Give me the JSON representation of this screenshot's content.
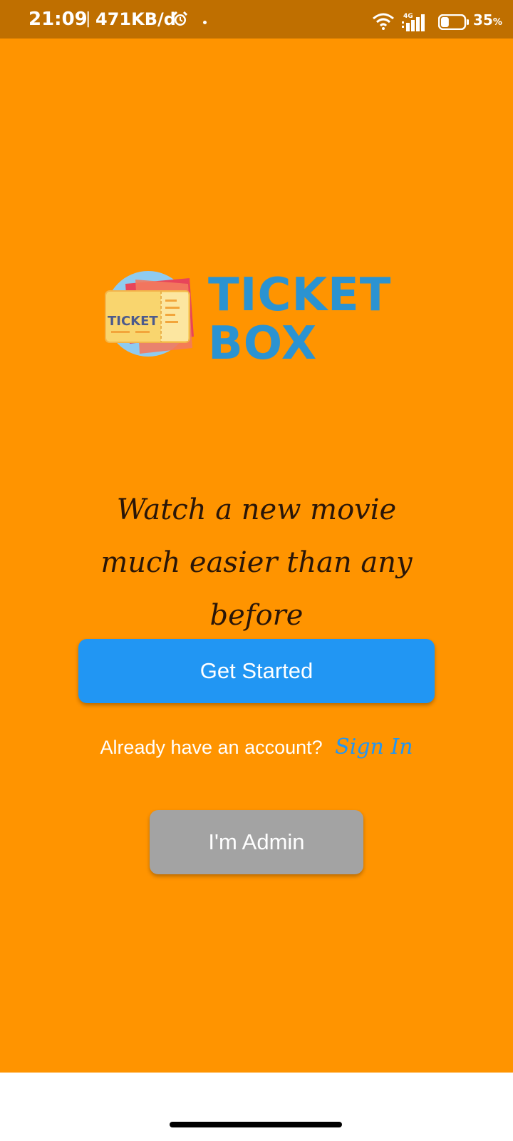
{
  "status_bar": {
    "time": "21:09",
    "separator": "|",
    "net_speed": "471KB/d",
    "network_type": "4G",
    "battery_percent": "35",
    "battery_unit": "%",
    "battery_level": 0.35,
    "icons": [
      "alarm-icon",
      "dot-icon",
      "wifi-icon",
      "signal-icon",
      "battery-icon"
    ]
  },
  "logo": {
    "badge_text": "TICKET",
    "title_line1": "TICKET",
    "title_line2": "BOX"
  },
  "tagline": "Watch a new movie much easier than any before",
  "actions": {
    "get_started": "Get Started",
    "signin_prompt": "Already have an account?",
    "signin_link": "Sign In",
    "admin": "I'm Admin"
  },
  "colors": {
    "background": "#FF9400",
    "status_bar": "#BF6F00",
    "primary": "#2196F3",
    "admin": "#A3A3A3",
    "logo_text": "#2B93D1"
  }
}
